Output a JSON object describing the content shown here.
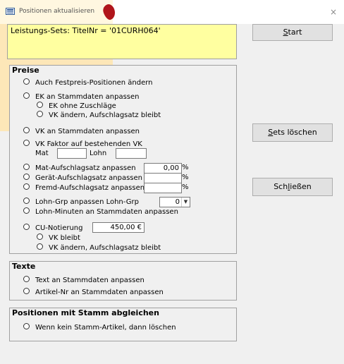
{
  "window": {
    "title": "Positionen aktualisieren",
    "close_glyph": "×"
  },
  "info": {
    "text": "Leistungs-Sets: TitelNr = '01CURH064'"
  },
  "buttons": {
    "start": {
      "accel": "S",
      "rest": "tart"
    },
    "sets_loeschen": {
      "accel": "S",
      "rest": "ets löschen"
    },
    "schliessen": {
      "pre": "Sch",
      "accel": "l",
      "rest": "ießen"
    }
  },
  "preise": {
    "title": "Preise",
    "festpreis": "Auch Festpreis-Positionen ändern",
    "ek_stamm": "EK an Stammdaten anpassen",
    "ek_ohne": "EK ohne Zuschläge",
    "vk_aendern_bleibt": "VK ändern, Aufschlagsatz bleibt",
    "vk_stamm": "VK an Stammdaten anpassen",
    "vk_faktor": "VK Faktor auf bestehenden VK",
    "mat_label": "Mat",
    "lohn_label": "Lohn",
    "mat_aufschlag": "Mat-Aufschlagsatz anpassen",
    "mat_aufschlag_value": "0,00",
    "geraet_aufschlag": "Gerät-Aufschlagsatz anpassen",
    "fremd_aufschlag": "Fremd-Aufschlagsatz anpassen",
    "percent": "%",
    "lohn_grp": "Lohn-Grp anpassen  Lohn-Grp",
    "lohn_grp_value": "0",
    "lohn_minuten": "Lohn-Minuten an Stammdaten anpassen",
    "cu_notierung": "CU-Notierung",
    "cu_value": "450,00 €",
    "vk_bleibt": "VK bleibt",
    "vk_aendern": "VK ändern, Aufschlagsatz bleibt"
  },
  "texte": {
    "title": "Texte",
    "text_stamm": "Text an Stammdaten anpassen",
    "artikel_nr": "Artikel-Nr an Stammdaten anpassen"
  },
  "abgleich": {
    "title": "Positionen mit Stamm abgleichen",
    "loeschen": "Wenn kein Stamm-Artikel, dann löschen"
  },
  "colors": {
    "info_bg": "#ffffa0",
    "accent_blob": "#b0151a",
    "side_highlight": "#fde7b8"
  }
}
